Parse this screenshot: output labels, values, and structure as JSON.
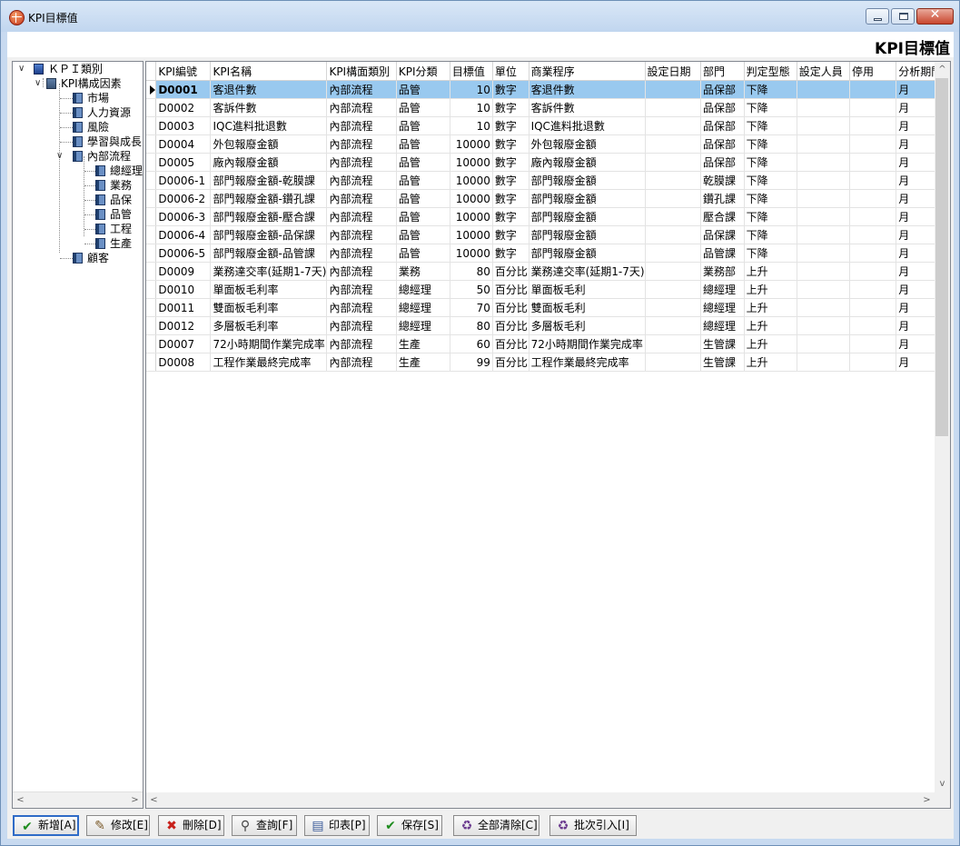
{
  "window": {
    "title": "KPI目標值"
  },
  "page": {
    "heading": "KPI目標值"
  },
  "tree": {
    "root": "ＫＰＩ類別",
    "group": "KPI構成因素",
    "items": [
      "市場",
      "人力資源",
      "風險",
      "學習與成長",
      "內部流程"
    ],
    "sub_items": [
      "總經理",
      "業務",
      "品保",
      "品管",
      "工程",
      "生產"
    ],
    "last_item": "顧客"
  },
  "grid": {
    "columns": [
      "KPI編號",
      "KPI名稱",
      "KPI構面類別",
      "KPI分類",
      "目標值",
      "單位",
      "商業程序",
      "設定日期",
      "部門",
      "判定型態",
      "設定人員",
      "停用",
      "分析期間"
    ],
    "rows": [
      [
        "D0001",
        "客退件數",
        "內部流程",
        "品管",
        "10",
        "數字",
        "客退件數",
        "",
        "品保部",
        "下降",
        "",
        "",
        "月"
      ],
      [
        "D0002",
        "客訴件數",
        "內部流程",
        "品管",
        "10",
        "數字",
        "客訴件數",
        "",
        "品保部",
        "下降",
        "",
        "",
        "月"
      ],
      [
        "D0003",
        "IQC進料批退數",
        "內部流程",
        "品管",
        "10",
        "數字",
        "IQC進料批退數",
        "",
        "品保部",
        "下降",
        "",
        "",
        "月"
      ],
      [
        "D0004",
        "外包報廢金額",
        "內部流程",
        "品管",
        "10000",
        "數字",
        "外包報廢金額",
        "",
        "品保部",
        "下降",
        "",
        "",
        "月"
      ],
      [
        "D0005",
        "廠內報廢金額",
        "內部流程",
        "品管",
        "10000",
        "數字",
        "廠內報廢金額",
        "",
        "品保部",
        "下降",
        "",
        "",
        "月"
      ],
      [
        "D0006-1",
        "部門報廢金額-乾膜課",
        "內部流程",
        "品管",
        "10000",
        "數字",
        "部門報廢金額",
        "",
        "乾膜課",
        "下降",
        "",
        "",
        "月"
      ],
      [
        "D0006-2",
        "部門報廢金額-鑽孔課",
        "內部流程",
        "品管",
        "10000",
        "數字",
        "部門報廢金額",
        "",
        "鑽孔課",
        "下降",
        "",
        "",
        "月"
      ],
      [
        "D0006-3",
        "部門報廢金額-壓合課",
        "內部流程",
        "品管",
        "10000",
        "數字",
        "部門報廢金額",
        "",
        "壓合課",
        "下降",
        "",
        "",
        "月"
      ],
      [
        "D0006-4",
        "部門報廢金額-品保課",
        "內部流程",
        "品管",
        "10000",
        "數字",
        "部門報廢金額",
        "",
        "品保課",
        "下降",
        "",
        "",
        "月"
      ],
      [
        "D0006-5",
        "部門報廢金額-品管課",
        "內部流程",
        "品管",
        "10000",
        "數字",
        "部門報廢金額",
        "",
        "品管課",
        "下降",
        "",
        "",
        "月"
      ],
      [
        "D0009",
        "業務達交率(延期1-7天)",
        "內部流程",
        "業務",
        "80",
        "百分比",
        "業務達交率(延期1-7天)",
        "",
        "業務部",
        "上升",
        "",
        "",
        "月"
      ],
      [
        "D0010",
        "單面板毛利率",
        "內部流程",
        "總經理",
        "50",
        "百分比",
        "單面板毛利",
        "",
        "總經理",
        "上升",
        "",
        "",
        "月"
      ],
      [
        "D0011",
        "雙面板毛利率",
        "內部流程",
        "總經理",
        "70",
        "百分比",
        "雙面板毛利",
        "",
        "總經理",
        "上升",
        "",
        "",
        "月"
      ],
      [
        "D0012",
        "多層板毛利率",
        "內部流程",
        "總經理",
        "80",
        "百分比",
        "多層板毛利",
        "",
        "總經理",
        "上升",
        "",
        "",
        "月"
      ],
      [
        "D0007",
        "72小時期間作業完成率",
        "內部流程",
        "生產",
        "60",
        "百分比",
        "72小時期間作業完成率",
        "",
        "生管課",
        "上升",
        "",
        "",
        "月"
      ],
      [
        "D0008",
        "工程作業最終完成率",
        "內部流程",
        "生產",
        "99",
        "百分比",
        "工程作業最終完成率",
        "",
        "生管課",
        "上升",
        "",
        "",
        "月"
      ]
    ],
    "selected_row": 0
  },
  "toolbar": {
    "add": "新增[A]",
    "edit": "修改[E]",
    "delete": "刪除[D]",
    "query": "查詢[F]",
    "print": "印表[P]",
    "save": "保存[S]",
    "clear_all": "全部清除[C]",
    "batch_import": "批次引入[I]"
  },
  "icons": {
    "app": "globe-icon",
    "add": "check-icon",
    "edit": "pencil-icon",
    "delete": "x-icon",
    "query": "magnifier-icon",
    "print": "printer-icon",
    "save": "check-icon",
    "clear_all": "recycle-bin-icon",
    "batch_import": "recycle-bin-icon"
  },
  "colors": {
    "selection": "#99c9ef",
    "title_bar": "#c8daf0",
    "default_button_border": "#2f6bc7",
    "close_button": "#c8462d"
  }
}
